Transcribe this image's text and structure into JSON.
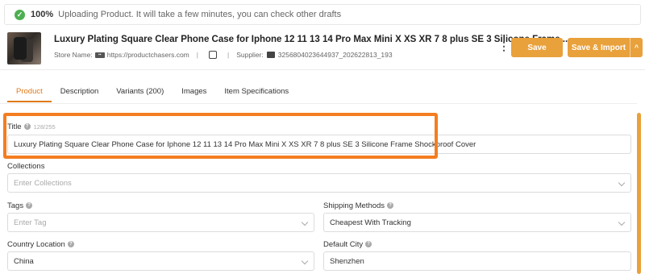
{
  "banner": {
    "percent": "100%",
    "message": "Uploading Product. It will take a few minutes, you can check other drafts"
  },
  "product": {
    "title": "Luxury Plating Square Clear Phone Case for Iphone 12 11 13 14 Pro Max Mini X XS XR 7 8 plus SE 3 Silicone Frame...",
    "store_label": "Store Name:",
    "store_url": "https://productchasers.com",
    "supplier_label": "Supplier:",
    "supplier_id": "3256804023644937_202622813_193"
  },
  "buttons": {
    "save": "Save",
    "save_import": "Save & Import",
    "caret": "^"
  },
  "tabs": [
    "Product",
    "Description",
    "Variants (200)",
    "Images",
    "Item Specifications"
  ],
  "form": {
    "title_label": "Title",
    "title_count": "128/255",
    "title_value": "Luxury Plating Square Clear Phone Case for Iphone 12 11 13 14 Pro Max Mini X XS XR 7 8 plus SE 3 Silicone Frame Shockproof Cover",
    "collections_label": "Collections",
    "collections_placeholder": "Enter Collections",
    "tags_label": "Tags",
    "tags_placeholder": "Enter Tag",
    "shipping_label": "Shipping Methods",
    "shipping_value": "Cheapest With Tracking",
    "country_label": "Country Location",
    "country_value": "China",
    "city_label": "Default City",
    "city_value": "Shenzhen"
  },
  "colors": {
    "accent": "#e9a13c",
    "highlight": "#f47d20",
    "active_tab": "#e07b1a",
    "success": "#4caf50"
  }
}
